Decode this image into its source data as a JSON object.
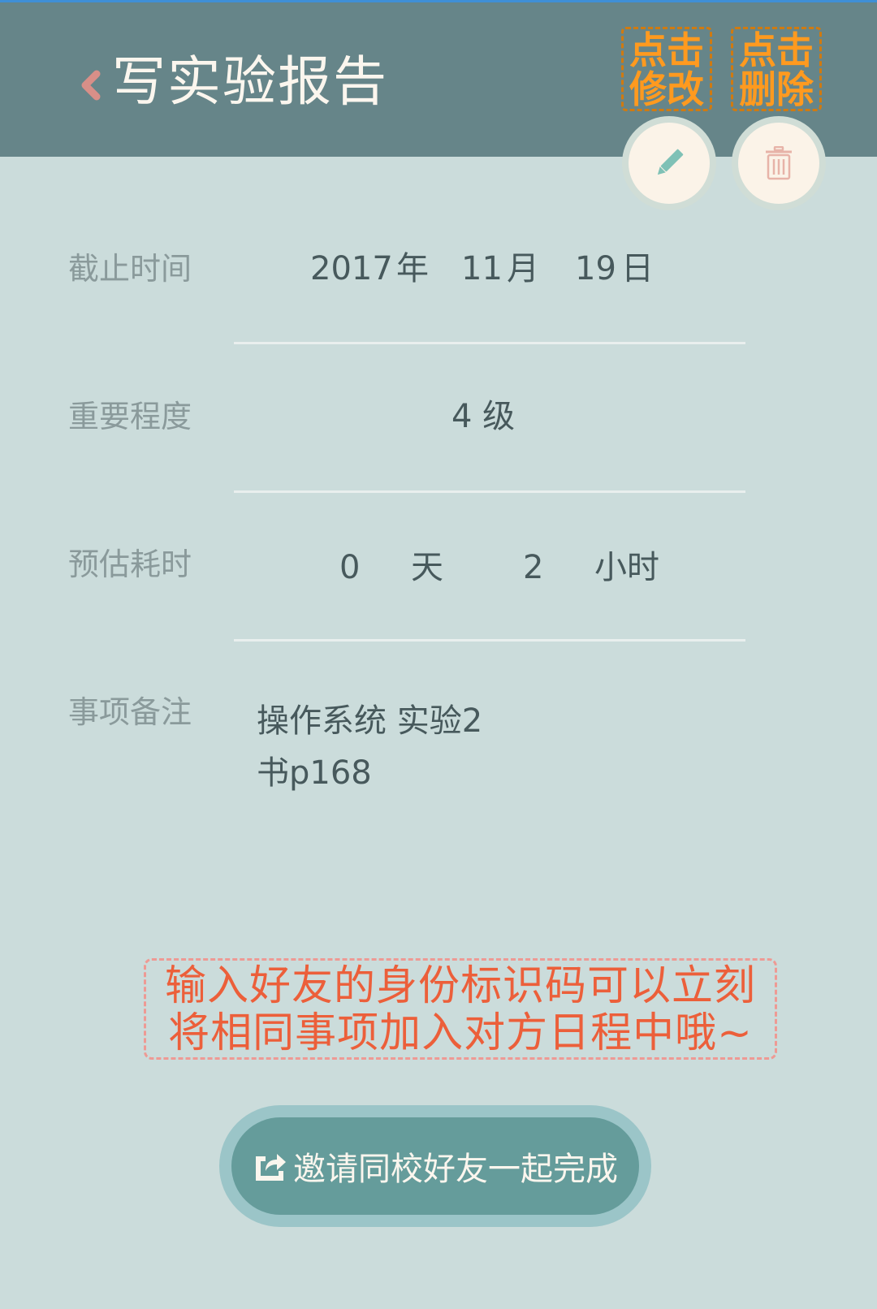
{
  "header": {
    "title": "写实验报告",
    "hint_edit": [
      "点击",
      "修改"
    ],
    "hint_delete": [
      "点击",
      "删除"
    ]
  },
  "deadline": {
    "label": "截止时间",
    "year": "2017",
    "year_unit": "年",
    "month": "11",
    "month_unit": "月",
    "day": "19",
    "day_unit": "日"
  },
  "importance": {
    "label": "重要程度",
    "value": "4 级"
  },
  "duration": {
    "label": "预估耗时",
    "days": "0",
    "days_unit": "天",
    "hours": "2",
    "hours_unit": "小时"
  },
  "notes": {
    "label": "事项备注",
    "line1": "操作系统 实验2",
    "line2": "书p168"
  },
  "tip": {
    "line1": "输入好友的身份标识码可以立刻",
    "line2": "将相同事项加入对方日程中哦~"
  },
  "invite": {
    "label": "邀请同校好友一起完成"
  },
  "colors": {
    "header": "#668589",
    "background": "#cbdcdb",
    "hint": "#ff9a1f",
    "tip": "#ec5f3a",
    "button": "#659c9b"
  },
  "icons": {
    "back": "chevron-left-icon",
    "edit": "pencil-icon",
    "delete": "trash-icon",
    "share": "share-icon"
  }
}
